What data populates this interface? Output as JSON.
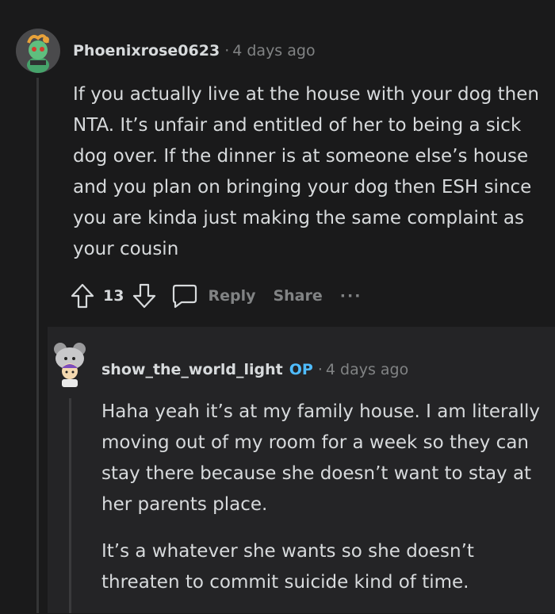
{
  "comment": {
    "author": "Phoenixrose0623",
    "separator": "·",
    "time": "4 days ago",
    "body": "If you actually live at the house with your dog then NTA. It’s unfair and entitled of her to being a sick dog over. If the dinner is at someone else’s house and you plan on bringing your dog then ESH since you are kinda just making the same complaint as your cousin",
    "actions": {
      "vote_count": "13",
      "reply_label": "Reply",
      "share_label": "Share",
      "more_label": "···"
    }
  },
  "reply": {
    "author": "show_the_world_light",
    "op_badge": "OP",
    "separator": "·",
    "time": "4 days ago",
    "paragraph1": "Haha yeah it’s at my family house. I am literally moving out of my room for a week so they can stay there because she doesn’t want to stay at her parents place.",
    "paragraph2": "It’s a whatever she wants so she doesn’t threaten to commit suicide kind of time."
  },
  "colors": {
    "background": "#1a1a1b",
    "reply_background": "#242426",
    "text": "#d7dadc",
    "muted": "#818384",
    "op_accent": "#4fbcff"
  },
  "icons": [
    "snoo-avatar-icon",
    "upvote-arrow-icon",
    "downvote-arrow-icon",
    "comment-bubble-icon",
    "more-options-icon"
  ]
}
